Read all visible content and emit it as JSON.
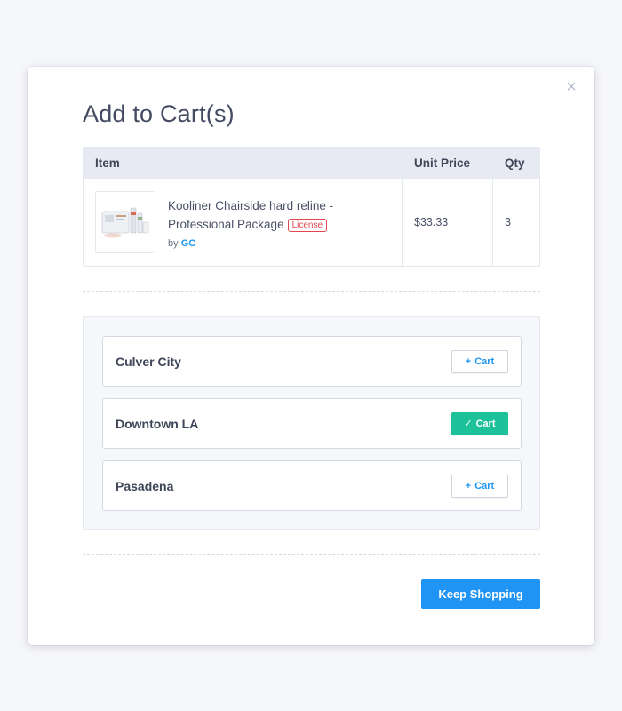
{
  "modal": {
    "title": "Add to Cart(s)",
    "close_label": "×"
  },
  "table": {
    "headers": {
      "item": "Item",
      "unit_price": "Unit Price",
      "qty": "Qty"
    },
    "row": {
      "product_name": "Kooliner Chairside hard reline - Professional Package",
      "badge": "License",
      "by_prefix": "by",
      "brand": "GC",
      "unit_price": "$33.33",
      "qty": "3"
    }
  },
  "locations": [
    {
      "name": "Culver City",
      "cart_label": "Cart",
      "state": "add",
      "glyph": "+"
    },
    {
      "name": "Downtown LA",
      "cart_label": "Cart",
      "state": "added",
      "glyph": "✓"
    },
    {
      "name": "Pasadena",
      "cart_label": "Cart",
      "state": "add",
      "glyph": "+"
    }
  ],
  "footer": {
    "keep_shopping": "Keep Shopping"
  },
  "colors": {
    "accent": "#1f94f5",
    "added": "#1dc29a",
    "badge": "#e2474f"
  },
  "icons": {
    "close": "close-icon",
    "add": "plus-icon",
    "added": "check-icon",
    "thumbnail": "product-image"
  }
}
